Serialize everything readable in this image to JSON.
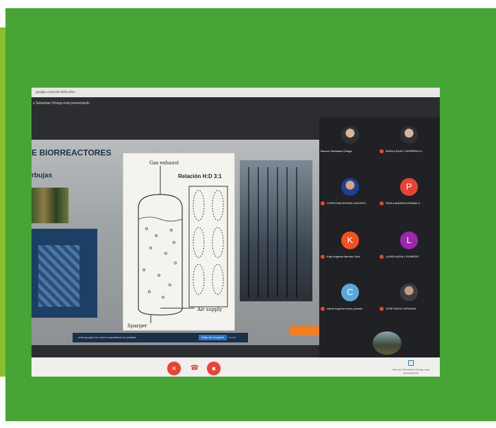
{
  "browser": {
    "url": "google.com/xdx-bhfs-wfnr"
  },
  "meet": {
    "presenting_banner": "s Sebastian Ortega está presentando",
    "notice_text": "meet.google.com está compartiendo tu pantalla.",
    "notice_stop_button": "Dejar de compartir",
    "notice_hide_button": "Ocultar",
    "presenter_footer": "Marcos Sebastian Ortega está presentando"
  },
  "slide": {
    "title": "E BIORREACTORES",
    "subtitle": "rbujas",
    "diagram_gas_exhaust": "Gas exhaust",
    "diagram_ratio": "Relación H:D 3:1",
    "diagram_air_supply": "Air supply",
    "diagram_sparger": "Sparger"
  },
  "participants": [
    {
      "name": "Marcos Sebastian Ortega",
      "initial": "",
      "color": "#2f2f35",
      "photo": true,
      "muted": false
    },
    {
      "name": "MARLA SUALY HERRERA O...",
      "initial": "",
      "color": "#2f2f35",
      "photo": true,
      "muted": true
    },
    {
      "name": "CHRISTIAN RIVERA CAICEDO",
      "initial": "",
      "color": "#2f2f35",
      "photo": true,
      "muted": true
    },
    {
      "name": "PAOLA ANDREA ROMAN H",
      "initial": "P",
      "color": "#ea4335",
      "photo": false,
      "muted": true
    },
    {
      "name": "Katy Angelica Benítez Ortiz",
      "initial": "K",
      "color": "#f4511e",
      "photo": false,
      "muted": true
    },
    {
      "name": "LAURA NATALY ROMERO",
      "initial": "L",
      "color": "#9c27b0",
      "photo": false,
      "muted": true
    },
    {
      "name": "carlos eugenio torres poveda",
      "initial": "C",
      "color": "#5ba8d8",
      "photo": false,
      "muted": true
    },
    {
      "name": "JOSE DAVID CARVAJAL",
      "initial": "",
      "color": "#2f2f35",
      "photo": true,
      "muted": true
    }
  ],
  "controls": {
    "mic_icon": "mic-off-icon",
    "hangup_icon": "call-end-icon",
    "camera_icon": "camera-off-icon"
  },
  "colors": {
    "frame_green": "#46a534",
    "left_bar": "#8bbf2c",
    "meet_red": "#ea4335",
    "orange": "#f08020"
  }
}
